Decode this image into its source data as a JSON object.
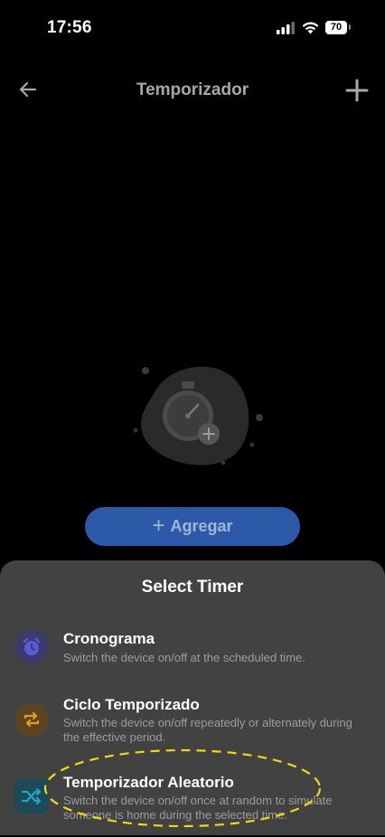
{
  "status_bar": {
    "time": "17:56",
    "battery": "70"
  },
  "nav": {
    "title": "Temporizador"
  },
  "main": {
    "add_button_label": "Agregar"
  },
  "sheet": {
    "title": "Select Timer",
    "options": [
      {
        "title": "Cronograma",
        "description": "Switch the device on/off at the scheduled time.",
        "icon": "alarm-clock-icon",
        "color": "#5a5bd6"
      },
      {
        "title": "Ciclo Temporizado",
        "description": "Switch the device on/off repeatedly or alternately during the effective period.",
        "icon": "repeat-icon",
        "color": "#e59b1f"
      },
      {
        "title": "Temporizador Aleatorio",
        "description": "Switch the device on/off once at random to simulate someone is home during the selected time.",
        "icon": "shuffle-icon",
        "color": "#22a6c8"
      }
    ]
  },
  "colors": {
    "highlight": "#f5d90a",
    "primary_button": "#2d5aa8"
  }
}
